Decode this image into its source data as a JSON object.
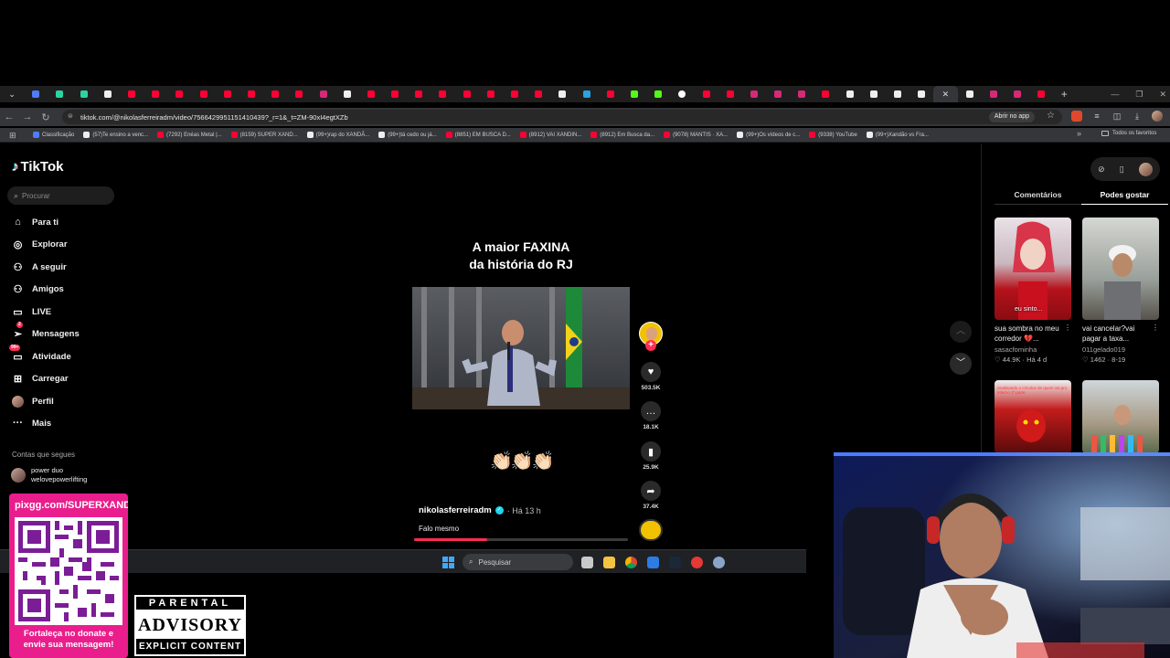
{
  "browser": {
    "url": "tiktok.com/@nikolasferreiradm/video/7566429951151410439?_r=1&_t=ZM-90xI4egtXZb",
    "open_app_label": "Abrir no app",
    "all_favorites_label": "Todos os favoritos",
    "tabs_close_glyph": "✕",
    "new_tab_glyph": "+",
    "bookmarks": [
      {
        "label": "Classificação",
        "color": "#4f7cff"
      },
      {
        "label": "(57)Te ensino a venc...",
        "color": "#111"
      },
      {
        "label": "(7292) Enéas Metal |...",
        "color": "#ff0033"
      },
      {
        "label": "(8159) SUPER XAND...",
        "color": "#ff0033"
      },
      {
        "label": "(99+)rap do XANDÃ...",
        "color": "#111"
      },
      {
        "label": "(99+)tá cedo ou já...",
        "color": "#111"
      },
      {
        "label": "(8851) EM BUSCA D...",
        "color": "#ff0033"
      },
      {
        "label": "(8912) VAI XANDIN...",
        "color": "#ff0033"
      },
      {
        "label": "(8912) Em Busca da...",
        "color": "#ff0033"
      },
      {
        "label": "(9078) MANTIS · XA...",
        "color": "#ff0033"
      },
      {
        "label": "(99+)Os vídeos de c...",
        "color": "#111"
      },
      {
        "label": "(9338) YouTube",
        "color": "#ff0033"
      },
      {
        "label": "(99+)Xandão vs Fra...",
        "color": "#111"
      }
    ]
  },
  "sidebar": {
    "logo": "TikTok",
    "search_placeholder": "Procurar",
    "items": [
      {
        "label": "Para ti",
        "icon": "home-icon",
        "glyph": "⌂"
      },
      {
        "label": "Explorar",
        "icon": "compass-icon",
        "glyph": "◎"
      },
      {
        "label": "A seguir",
        "icon": "following-icon",
        "glyph": "⚇"
      },
      {
        "label": "Amigos",
        "icon": "friends-icon",
        "glyph": "⚇"
      },
      {
        "label": "LIVE",
        "icon": "live-icon",
        "glyph": "▭"
      },
      {
        "label": "Mensagens",
        "icon": "messages-icon",
        "glyph": "➢",
        "badge": "2"
      },
      {
        "label": "Atividade",
        "icon": "activity-icon",
        "glyph": "▭",
        "badge": "99+"
      },
      {
        "label": "Carregar",
        "icon": "upload-icon",
        "glyph": "⊞"
      },
      {
        "label": "Perfil",
        "icon": "profile-icon",
        "glyph": "●"
      },
      {
        "label": "Mais",
        "icon": "more-icon",
        "glyph": "···"
      }
    ],
    "following_title": "Contas que segues",
    "following_name": "power duo",
    "following_handle": "welovepowerlifting"
  },
  "video": {
    "title_line1": "A maior FAXINA",
    "title_line2": "da história do RJ",
    "emoji": "👏🏻👏🏻👏🏻",
    "author": "nikolasferreiradm",
    "time": "· Há 13 h",
    "caption": "Falo mesmo",
    "progress": 0.34,
    "likes": "503.5K",
    "comments": "18.1K",
    "saves": "25.9K",
    "shares": "37.4K"
  },
  "right_panel": {
    "tab_comments": "Comentários",
    "tab_you_may_like": "Podes gostar",
    "cards": [
      {
        "title": "sua sombra no meu corredor 💔...",
        "user": "sasacfominha",
        "stats": "♡ 44.9K · Há 4 d",
        "overlay": "eu sinto..."
      },
      {
        "title": "vai cancelar?vai pagar a taxa...",
        "user": "011gelado019",
        "stats": "♡ 1462 · 8-19",
        "overlay": ""
      },
      {
        "title": "",
        "user": "",
        "stats": "",
        "overlay": "Analisando o círculos de quem vai pro inferno 1ª parte"
      },
      {
        "title": "",
        "user": "",
        "stats": "",
        "overlay": ""
      }
    ]
  },
  "taskbar": {
    "search_placeholder": "Pesquisar"
  },
  "overlay": {
    "donate_url": "pixgg.com/SUPERXAND",
    "donate_msg_line1": "Fortaleça no donate e",
    "donate_msg_line2": "envie sua mensagem!",
    "advisory_top": "PARENTAL",
    "advisory_mid": "ADVISORY",
    "advisory_bottom": "EXPLICIT CONTENT"
  }
}
